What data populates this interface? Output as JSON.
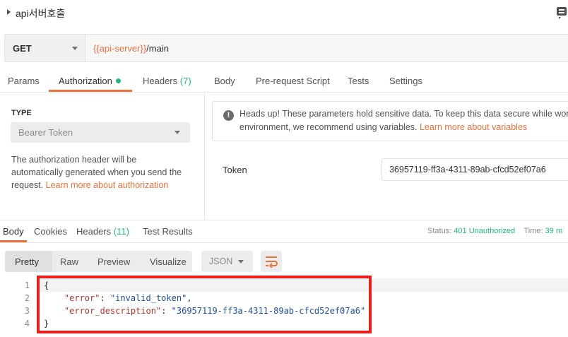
{
  "request": {
    "name": "api서버호출",
    "method": "GET",
    "url_variable": "{{api-server}}",
    "url_path": "/main"
  },
  "request_tabs": {
    "params": "Params",
    "authorization": "Authorization",
    "headers": "Headers",
    "headers_count": "(7)",
    "body": "Body",
    "prerequest": "Pre-request Script",
    "tests": "Tests",
    "settings": "Settings"
  },
  "auth": {
    "type_label": "TYPE",
    "type_value": "Bearer Token",
    "desc_lines": [
      "The authorization header will be",
      "automatically generated when you send the",
      "request. "
    ],
    "desc_link": "Learn more about authorization",
    "warning_line1": "Heads up! These parameters hold sensitive data. To keep this data secure while wor",
    "warning_line2": "environment, we recommend using variables. ",
    "warning_link": "Learn more about variables",
    "token_label": "Token",
    "token_value": "36957119-ff3a-4311-89ab-cfcd52ef07a6"
  },
  "response_tabs": {
    "body": "Body",
    "cookies": "Cookies",
    "headers": "Headers",
    "headers_count": "(11)",
    "test_results": "Test Results",
    "status_label": "Status:",
    "status_value": "401 Unauthorized",
    "time_label": "Time:",
    "time_value": "39 m"
  },
  "view_modes": [
    "Pretty",
    "Raw",
    "Preview",
    "Visualize"
  ],
  "format": "JSON",
  "response_body": {
    "line_numbers": [
      "1",
      "2",
      "3",
      "4"
    ],
    "open_brace": "{",
    "close_brace": "}",
    "error_key": "\"error\"",
    "error_value": "\"invalid_token\"",
    "desc_key": "\"error_description\"",
    "desc_value": "\"36957119-ff3a-4311-89ab-cfcd52ef07a6\""
  },
  "colors": {
    "accent": "#e8713c",
    "success": "#26b47f",
    "highlight_box": "#e8201b"
  }
}
